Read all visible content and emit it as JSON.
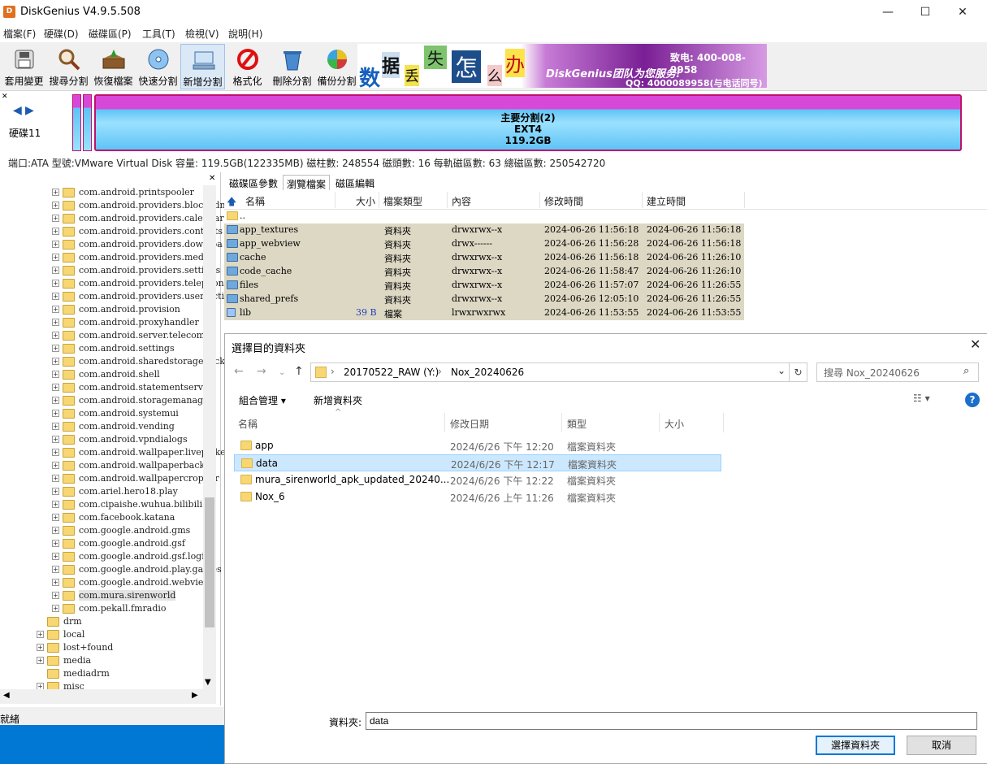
{
  "app": {
    "title": "DiskGenius V4.9.5.508",
    "icon_text": "D"
  },
  "window": {
    "min": "—",
    "max": "☐",
    "close": "✕"
  },
  "menu": [
    "檔案(F)",
    "硬碟(D)",
    "磁碟區(P)",
    "工具(T)",
    "檢視(V)",
    "說明(H)"
  ],
  "toolbar": [
    {
      "label": "套用變更",
      "icon": "save-disk-icon"
    },
    {
      "label": "搜尋分割",
      "icon": "magnifier-icon"
    },
    {
      "label": "恢復檔案",
      "icon": "recover-box-icon"
    },
    {
      "label": "快速分割",
      "icon": "disc-icon"
    },
    {
      "label": "新增分割",
      "icon": "new-partition-icon"
    },
    {
      "label": "格式化",
      "icon": "format-icon"
    },
    {
      "label": "刪除分割",
      "icon": "trash-icon"
    },
    {
      "label": "備份分割",
      "icon": "backup-pie-icon"
    }
  ],
  "banner": {
    "chars": [
      "数",
      "据",
      "丢",
      "失",
      "怎",
      "么",
      "办"
    ],
    "brand": "DiskGenius团队为您服务!",
    "phone": "致电: 400-008-9958",
    "qq": "QQ: 4000089958(与电话同号)"
  },
  "disk": {
    "label": "硬碟11",
    "partition_name": "主要分割(2)",
    "partition_fs": "EXT4",
    "partition_size": "119.2GB",
    "info": "端口:ATA 型號:VMware Virtual Disk 容量: 119.5GB(122335MB) 磁柱數: 248554 磁頭數: 16 每軌磁區數: 63 總磁區數: 250542720"
  },
  "tree": [
    {
      "label": "com.android.printspooler",
      "indent": 2,
      "expand": true
    },
    {
      "label": "com.android.providers.blockedn",
      "indent": 2,
      "expand": true
    },
    {
      "label": "com.android.providers.calendar",
      "indent": 2,
      "expand": true
    },
    {
      "label": "com.android.providers.contacts",
      "indent": 2,
      "expand": true
    },
    {
      "label": "com.android.providers.downloa",
      "indent": 2,
      "expand": true
    },
    {
      "label": "com.android.providers.media",
      "indent": 2,
      "expand": true
    },
    {
      "label": "com.android.providers.settings",
      "indent": 2,
      "expand": true
    },
    {
      "label": "com.android.providers.telephon",
      "indent": 2,
      "expand": true
    },
    {
      "label": "com.android.providers.userdictic",
      "indent": 2,
      "expand": true
    },
    {
      "label": "com.android.provision",
      "indent": 2,
      "expand": true
    },
    {
      "label": "com.android.proxyhandler",
      "indent": 2,
      "expand": true
    },
    {
      "label": "com.android.server.telecom",
      "indent": 2,
      "expand": true
    },
    {
      "label": "com.android.settings",
      "indent": 2,
      "expand": true
    },
    {
      "label": "com.android.sharedstoragebacku",
      "indent": 2,
      "expand": true
    },
    {
      "label": "com.android.shell",
      "indent": 2,
      "expand": true
    },
    {
      "label": "com.android.statementservice",
      "indent": 2,
      "expand": true
    },
    {
      "label": "com.android.storagemanager",
      "indent": 2,
      "expand": true
    },
    {
      "label": "com.android.systemui",
      "indent": 2,
      "expand": true
    },
    {
      "label": "com.android.vending",
      "indent": 2,
      "expand": true
    },
    {
      "label": "com.android.vpndialogs",
      "indent": 2,
      "expand": true
    },
    {
      "label": "com.android.wallpaper.livepicke",
      "indent": 2,
      "expand": true
    },
    {
      "label": "com.android.wallpaperbackup",
      "indent": 2,
      "expand": true
    },
    {
      "label": "com.android.wallpapercropper",
      "indent": 2,
      "expand": true
    },
    {
      "label": "com.ariel.hero18.play",
      "indent": 2,
      "expand": true
    },
    {
      "label": "com.cipaishe.wuhua.bilibili",
      "indent": 2,
      "expand": true
    },
    {
      "label": "com.facebook.katana",
      "indent": 2,
      "expand": true
    },
    {
      "label": "com.google.android.gms",
      "indent": 2,
      "expand": true
    },
    {
      "label": "com.google.android.gsf",
      "indent": 2,
      "expand": true
    },
    {
      "label": "com.google.android.gsf.login",
      "indent": 2,
      "expand": true
    },
    {
      "label": "com.google.android.play.games",
      "indent": 2,
      "expand": true
    },
    {
      "label": "com.google.android.webview",
      "indent": 2,
      "expand": true
    },
    {
      "label": "com.mura.sirenworld",
      "indent": 2,
      "expand": true,
      "selected": true
    },
    {
      "label": "com.pekall.fmradio",
      "indent": 2,
      "expand": true
    },
    {
      "label": "drm",
      "indent": 1,
      "expand": false
    },
    {
      "label": "local",
      "indent": 1,
      "expand": true
    },
    {
      "label": "lost+found",
      "indent": 1,
      "expand": true
    },
    {
      "label": "media",
      "indent": 1,
      "expand": true
    },
    {
      "label": "mediadrm",
      "indent": 1,
      "expand": false
    },
    {
      "label": "misc",
      "indent": 1,
      "expand": true
    }
  ],
  "status": "就緒",
  "right_tabs": [
    "磁碟區參數",
    "瀏覽檔案",
    "磁區編輯"
  ],
  "file_columns": [
    "名稱",
    "大小",
    "檔案類型",
    "內容",
    "修改時間",
    "建立時間"
  ],
  "files": [
    {
      "name": "..",
      "size": "",
      "type": "",
      "attr": "",
      "modified": "",
      "created": "",
      "kind": "up"
    },
    {
      "name": "app_textures",
      "size": "",
      "type": "資料夾",
      "attr": "drwxrwx--x",
      "modified": "2024-06-26 11:56:18",
      "created": "2024-06-26 11:56:18",
      "kind": "folder"
    },
    {
      "name": "app_webview",
      "size": "",
      "type": "資料夾",
      "attr": "drwx------",
      "modified": "2024-06-26 11:56:28",
      "created": "2024-06-26 11:56:18",
      "kind": "folder"
    },
    {
      "name": "cache",
      "size": "",
      "type": "資料夾",
      "attr": "drwxrwx--x",
      "modified": "2024-06-26 11:56:18",
      "created": "2024-06-26 11:26:10",
      "kind": "folder"
    },
    {
      "name": "code_cache",
      "size": "",
      "type": "資料夾",
      "attr": "drwxrwx--x",
      "modified": "2024-06-26 11:58:47",
      "created": "2024-06-26 11:26:10",
      "kind": "folder"
    },
    {
      "name": "files",
      "size": "",
      "type": "資料夾",
      "attr": "drwxrwx--x",
      "modified": "2024-06-26 11:57:07",
      "created": "2024-06-26 11:26:55",
      "kind": "folder"
    },
    {
      "name": "shared_prefs",
      "size": "",
      "type": "資料夾",
      "attr": "drwxrwx--x",
      "modified": "2024-06-26 12:05:10",
      "created": "2024-06-26 11:26:55",
      "kind": "folder"
    },
    {
      "name": "lib",
      "size": "39 B",
      "type": "檔案",
      "attr": "lrwxrwxrwx",
      "modified": "2024-06-26 11:53:55",
      "created": "2024-06-26 11:53:55",
      "kind": "file"
    }
  ],
  "dialog": {
    "title": "選擇目的資料夾",
    "path": [
      "20170522_RAW (Y:)",
      "Nox_20240626"
    ],
    "search_placeholder": "搜尋 Nox_20240626",
    "organize": "組合管理 ▾",
    "new_folder": "新增資料夾",
    "columns": [
      "名稱",
      "修改日期",
      "類型",
      "大小"
    ],
    "items": [
      {
        "name": "app",
        "date": "2024/6/26 下午 12:20",
        "type": "檔案資料夾"
      },
      {
        "name": "data",
        "date": "2024/6/26 下午 12:17",
        "type": "檔案資料夾",
        "selected": true
      },
      {
        "name": "mura_sirenworld_apk_updated_20240...",
        "date": "2024/6/26 下午 12:22",
        "type": "檔案資料夾"
      },
      {
        "name": "Nox_6",
        "date": "2024/6/26 上午 11:26",
        "type": "檔案資料夾"
      }
    ],
    "folder_label": "資料夾:",
    "folder_value": "data",
    "select_button": "選擇資料夾",
    "cancel_button": "取消"
  }
}
